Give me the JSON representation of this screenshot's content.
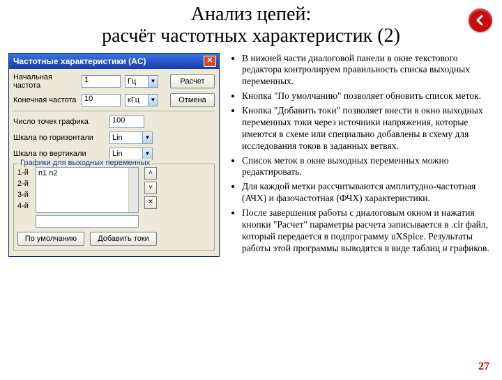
{
  "slide": {
    "title": "Анализ цепей:\nрасчёт частотных характеристик (2)",
    "page_number": "27"
  },
  "dialog": {
    "title": "Частотные характеристики (AC)",
    "close_glyph": "✕",
    "fields": {
      "start_label": "Начальная частота",
      "start_value": "1",
      "start_unit": "Гц",
      "end_label": "Конечная частота",
      "end_value": "10",
      "end_unit": "кГц",
      "points_label": "Число точек графика",
      "points_value": "100",
      "xscale_label": "Шкала по горизонтали",
      "xscale_value": "Lin",
      "yscale_label": "Шкала по вертикали",
      "yscale_value": "Lin"
    },
    "buttons": {
      "calc": "Расчет",
      "cancel": "Отмена",
      "defaults": "По умолчанию",
      "add_currents": "Добавить токи"
    },
    "group": {
      "legend": "Графики для выходных переменных",
      "axes": [
        "1-й",
        "2-й",
        "3-й",
        "4-й"
      ],
      "list_text": "n1 n2",
      "side": {
        "up": "˄",
        "down": "˅",
        "del": "✕"
      }
    }
  },
  "bullets": [
    "В нижней части диалоговой панели в окне текстового редактора контролируем правильность списка выходных переменных.",
    "Кнопка \"По умолчанию\" позволяет обновить список меток.",
    "Кнопка \"Добавить токи\" позволяет внести в окно выходных переменных токи через источники напряжения, которые имеются в схеме или специально добавлены в схему для исследования токов в заданных ветвях.",
    "Список меток в окне выходных переменных можно редактировать.",
    "Для каждой метки рассчитываются амплитудно-частотная (АЧХ) и фазочастотная (ФЧХ) характеристики.",
    "После завершения работы с диалоговым окном и нажатия кнопки \"Расчет\" параметры расчета записывается в .cir файл, который передается в подпрограмму uXSpice. Результаты работы этой программы выводятся в виде таблиц и графиков."
  ]
}
